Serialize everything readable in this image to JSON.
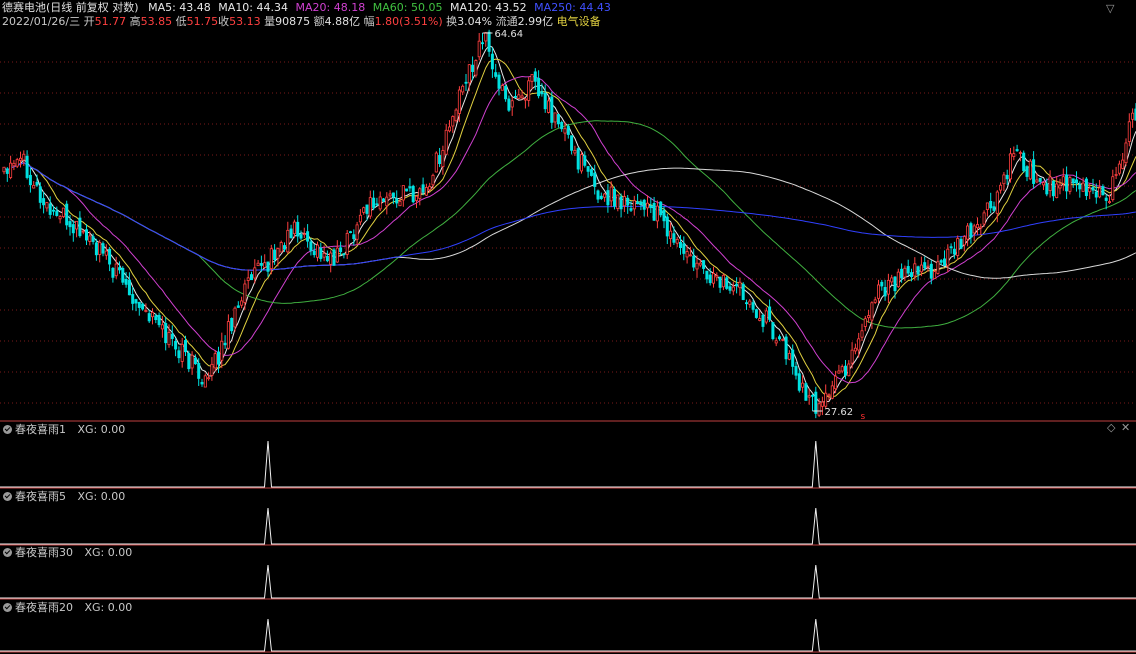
{
  "header": {
    "stock_name": "德赛电池",
    "period_mode": "(日线 前复权 对数)",
    "ma": [
      {
        "label": "MA5: 43.48",
        "color": "#e8e8e8"
      },
      {
        "label": "MA10: 44.34",
        "color": "#e8e8e8"
      },
      {
        "label": "MA20: 48.18",
        "color": "#d040d0"
      },
      {
        "label": "MA60: 50.05",
        "color": "#40c040"
      },
      {
        "label": "MA120: 43.52",
        "color": "#e8e8e8"
      },
      {
        "label": "MA250: 44.43",
        "color": "#4050ff"
      }
    ],
    "date": "2022/01/26/三",
    "open_label": "开",
    "open": "51.77",
    "high_label": "高",
    "high": "53.85",
    "low_label": "低",
    "low": "51.75",
    "close_label": "收",
    "close": "53.13",
    "vol_label": "量",
    "vol": "90875",
    "amt_label": "额",
    "amt": "4.88亿",
    "chg_label": "幅",
    "chg": "1.80(3.51%)",
    "turn_label": "换",
    "turn": "3.04%",
    "float_label": "流通",
    "float": "2.99亿",
    "sector": "电气设备"
  },
  "annotations": {
    "high_label": "64.64",
    "low_label": "27.62",
    "marker": "s"
  },
  "colors": {
    "up": "#ff4040",
    "down": "#00e0e0",
    "grid": "#7a1a1a",
    "ma5": "#e8e8e8",
    "ma10": "#e0d040",
    "ma20": "#d040d0",
    "ma60": "#40b040",
    "ma120": "#d8d8d8",
    "ma250": "#3040ff"
  },
  "chart_data": [
    {
      "type": "candlestick",
      "title": "德赛电池(日线 前复权 对数)",
      "scale": "log",
      "ylim": [
        27.62,
        64.64
      ],
      "grid": true,
      "annotated_high": 64.64,
      "annotated_low": 27.62,
      "key_points": [
        {
          "index": 0,
          "price": 48.0
        },
        {
          "index": 5,
          "price": 49.5
        },
        {
          "index": 12,
          "price": 44.0
        },
        {
          "index": 25,
          "price": 41.0
        },
        {
          "index": 45,
          "price": 34.0
        },
        {
          "index": 62,
          "price": 29.5
        },
        {
          "index": 72,
          "price": 36.0
        },
        {
          "index": 88,
          "price": 41.5
        },
        {
          "index": 100,
          "price": 38.5
        },
        {
          "index": 110,
          "price": 44.0
        },
        {
          "index": 128,
          "price": 45.5
        },
        {
          "index": 140,
          "price": 58.0
        },
        {
          "index": 145,
          "price": 64.64
        },
        {
          "index": 152,
          "price": 55.0
        },
        {
          "index": 160,
          "price": 57.5
        },
        {
          "index": 170,
          "price": 51.5
        },
        {
          "index": 180,
          "price": 45.0
        },
        {
          "index": 195,
          "price": 44.0
        },
        {
          "index": 210,
          "price": 38.0
        },
        {
          "index": 225,
          "price": 36.0
        },
        {
          "index": 235,
          "price": 32.5
        },
        {
          "index": 245,
          "price": 27.62
        },
        {
          "index": 255,
          "price": 30.5
        },
        {
          "index": 265,
          "price": 36.5
        },
        {
          "index": 285,
          "price": 38.5
        },
        {
          "index": 300,
          "price": 44.0
        },
        {
          "index": 306,
          "price": 49.0
        },
        {
          "index": 315,
          "price": 46.0
        },
        {
          "index": 325,
          "price": 45.5
        },
        {
          "index": 335,
          "price": 45.0
        },
        {
          "index": 342,
          "price": 53.13
        }
      ]
    },
    {
      "type": "line",
      "name": "春夜喜雨1",
      "value_label": "XG: 0.00",
      "signal_indices": [
        80,
        246
      ]
    },
    {
      "type": "line",
      "name": "春夜喜雨5",
      "value_label": "XG: 0.00",
      "signal_indices": [
        80,
        246
      ]
    },
    {
      "type": "line",
      "name": "春夜喜雨30",
      "value_label": "XG: 0.00",
      "signal_indices": [
        80,
        246
      ]
    },
    {
      "type": "line",
      "name": "春夜喜雨20",
      "value_label": "XG: 0.00",
      "signal_indices": [
        80,
        246
      ]
    }
  ]
}
